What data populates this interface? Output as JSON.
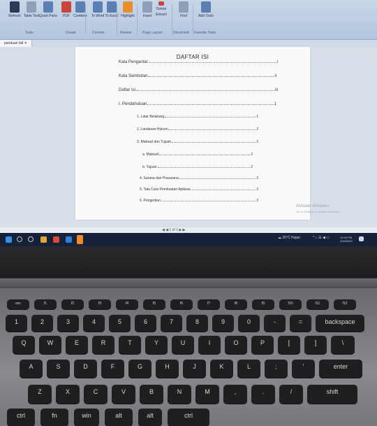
{
  "ribbon": {
    "items": [
      "Refresh",
      "Table Tool",
      "Quick Parts",
      "PDF",
      "Combine",
      "To Word",
      "To Excel",
      "Highlight",
      "Insert",
      "Delete",
      "Extract",
      "Find",
      "Add Tools"
    ],
    "groups": [
      "Tools",
      "Create",
      "Convert",
      "Review",
      "Page Layout",
      "Document",
      "Favorite Tools"
    ]
  },
  "doc_tab": {
    "label": "panduan fall"
  },
  "toc": {
    "title": "DAFTAR ISI",
    "entries": [
      {
        "text": "Kata Pengantar",
        "page": "i"
      },
      {
        "text": "Kata Sambutan",
        "page": "ii"
      },
      {
        "text": "Daftar Isi",
        "page": "iii"
      },
      {
        "text": "I. Pendahuluan",
        "page": "1"
      },
      {
        "text": "1. Latar Belakang",
        "page": "1"
      },
      {
        "text": "2. Landasan Hukum",
        "page": "2"
      },
      {
        "text": "3. Maksud dan Tujuan",
        "page": "2"
      },
      {
        "text": "a. Maksud",
        "page": "2"
      },
      {
        "text": "b. Tujuan",
        "page": "2"
      },
      {
        "text": "4. Sarana dan Prasarana",
        "page": "3"
      },
      {
        "text": "5. Tata Cara Pembuatan Aplikasi",
        "page": "3"
      },
      {
        "text": "6. Pengertian",
        "page": "3"
      }
    ]
  },
  "statusbar": {
    "page_nav": "1 of 1"
  },
  "activate": {
    "title": "Activate Windows",
    "subtitle": "Go to Settings to activate Windows."
  },
  "taskbar": {
    "weather": "25°C Hujan",
    "time": "10:40 PM",
    "date": "4/16/2022"
  },
  "keyboard": {
    "row_fn": [
      "esc",
      "f1",
      "f2",
      "f3",
      "f4",
      "f5",
      "f6",
      "f7",
      "f8",
      "f9",
      "f10",
      "f11",
      "f12"
    ],
    "row_num": [
      "1",
      "2",
      "3",
      "4",
      "5",
      "6",
      "7",
      "8",
      "9",
      "0",
      "-",
      "=",
      "backspace"
    ],
    "row_q": [
      "Q",
      "W",
      "E",
      "R",
      "T",
      "Y",
      "U",
      "I",
      "O",
      "P",
      "[",
      "]",
      "\\"
    ],
    "row_a": [
      "A",
      "S",
      "D",
      "F",
      "G",
      "H",
      "J",
      "K",
      "L",
      ";",
      "'",
      "enter"
    ],
    "row_z": [
      "Z",
      "X",
      "C",
      "V",
      "B",
      "N",
      "M",
      ",",
      ".",
      "/",
      "shift"
    ],
    "row_bottom": [
      "ctrl",
      "fn",
      "win",
      "alt",
      "alt",
      "ctrl"
    ]
  },
  "colors": {
    "taskbar": "#172238",
    "ribbon": "#c8d6e8",
    "keys": "#1f1f22"
  }
}
